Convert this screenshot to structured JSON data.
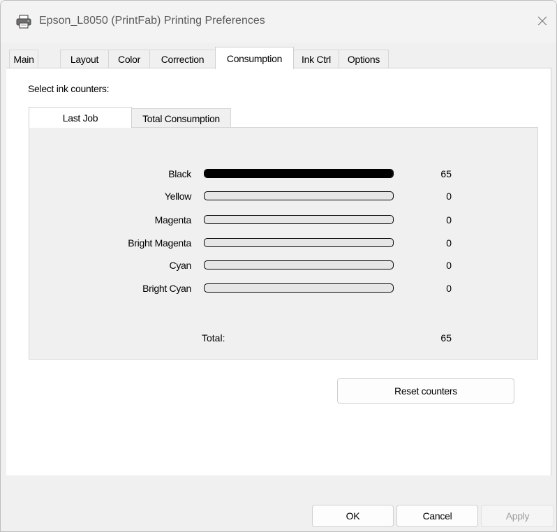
{
  "window": {
    "title": "Epson_L8050 (PrintFab) Printing Preferences"
  },
  "tabs": [
    {
      "label": "Main",
      "active": false
    },
    {
      "label": "Layout",
      "active": false
    },
    {
      "label": "Color",
      "active": false
    },
    {
      "label": "Correction",
      "active": false
    },
    {
      "label": "Consumption",
      "active": true
    },
    {
      "label": "Ink Ctrl",
      "active": false
    },
    {
      "label": "Options",
      "active": false
    }
  ],
  "consumption": {
    "select_label": "Select ink counters:",
    "inner_tabs": [
      {
        "label": "Last Job",
        "active": true
      },
      {
        "label": "Total Consumption",
        "active": false
      }
    ],
    "inks": [
      {
        "name": "Black",
        "value": "65",
        "fill_percent": 100
      },
      {
        "name": "Yellow",
        "value": "0",
        "fill_percent": 0
      },
      {
        "name": "Magenta",
        "value": "0",
        "fill_percent": 0
      },
      {
        "name": "Bright Magenta",
        "value": "0",
        "fill_percent": 0
      },
      {
        "name": "Cyan",
        "value": "0",
        "fill_percent": 0
      },
      {
        "name": "Bright Cyan",
        "value": "0",
        "fill_percent": 0
      }
    ],
    "total_label": "Total:",
    "total_value": "65",
    "reset_label": "Reset counters"
  },
  "footer": {
    "ok_label": "OK",
    "cancel_label": "Cancel",
    "apply_label": "Apply"
  },
  "colors": {
    "ink_bar_fill": "#000000",
    "ink_bar_empty": "#e6e6e6"
  }
}
